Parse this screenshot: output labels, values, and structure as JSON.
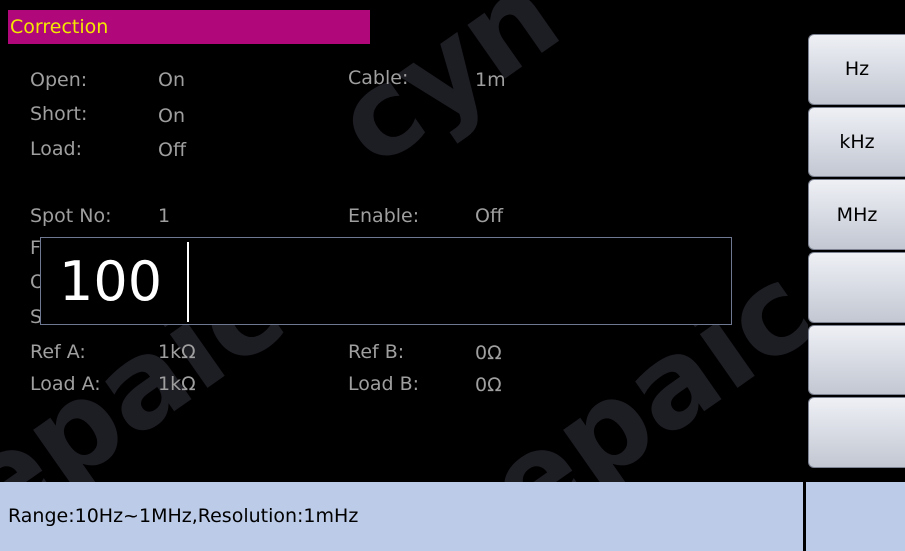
{
  "title": "Correction",
  "fields": {
    "open_label": "Open:",
    "open_value": "On",
    "short_label": "Short:",
    "short_value": "On",
    "load_label": "Load:",
    "load_value": "Off",
    "cable_label": "Cable:",
    "cable_value": "1m",
    "spot_label": "Spot No:",
    "spot_value": "1",
    "enable_label": "Enable:",
    "enable_value": "Off",
    "freq_label_partial": "Fr",
    "open2_label_partial": "O",
    "short2_label_partial": "Sh",
    "ref_a_label": "Ref A:",
    "ref_a_value": "1kΩ",
    "ref_b_label": "Ref B:",
    "ref_b_value": "0Ω",
    "load_a_label": "Load A:",
    "load_a_value": "1kΩ",
    "load_b_label": "Load B:",
    "load_b_value": "0Ω"
  },
  "entry": {
    "value": "100"
  },
  "softkeys": [
    "Hz",
    "kHz",
    "MHz",
    "",
    "",
    ""
  ],
  "status": {
    "text": "Range:10Hz~1MHz,Resolution:1mHz"
  },
  "colors": {
    "title_bg": "#b0087a",
    "title_text": "#f4e800",
    "label_gray": "#9f9f9f",
    "status_bg": "#bccbe8"
  }
}
